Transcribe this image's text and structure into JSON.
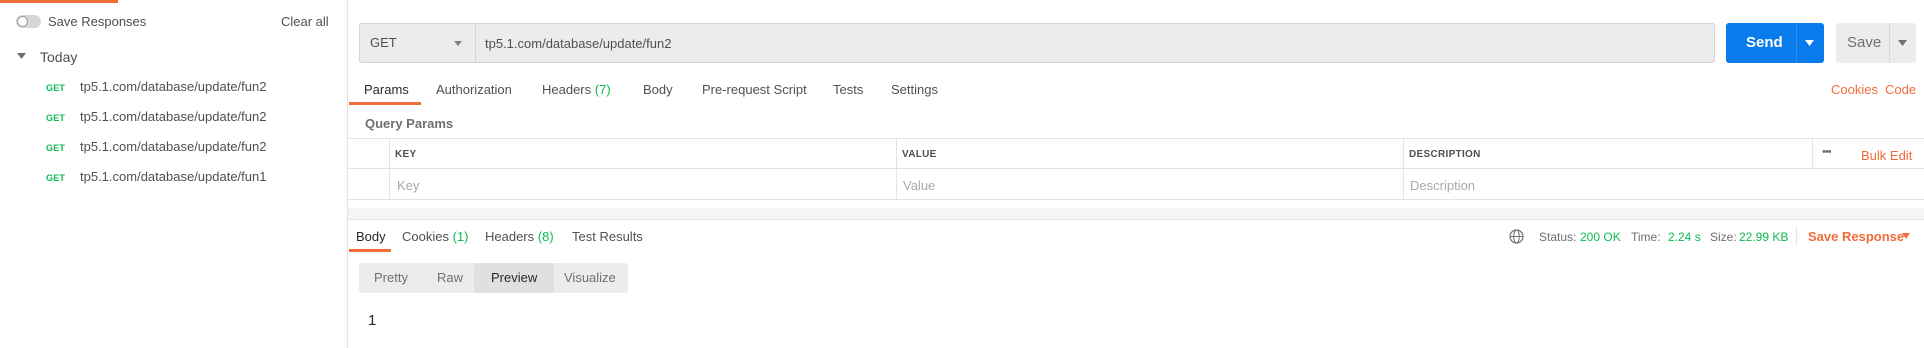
{
  "sidebar": {
    "save_responses_label": "Save Responses",
    "clear_all_label": "Clear all",
    "group_label": "Today",
    "history": [
      {
        "method": "GET",
        "url": "tp5.1.com/database/update/fun2"
      },
      {
        "method": "GET",
        "url": "tp5.1.com/database/update/fun2"
      },
      {
        "method": "GET",
        "url": "tp5.1.com/database/update/fun2"
      },
      {
        "method": "GET",
        "url": "tp5.1.com/database/update/fun1"
      }
    ]
  },
  "request": {
    "method": "GET",
    "url": "tp5.1.com/database/update/fun2",
    "send_label": "Send",
    "save_label": "Save"
  },
  "request_tabs": {
    "params": "Params",
    "authorization": "Authorization",
    "headers": "Headers",
    "headers_count": "(7)",
    "body": "Body",
    "prerequest": "Pre-request Script",
    "tests": "Tests",
    "settings": "Settings",
    "active": "Params"
  },
  "links": {
    "cookies": "Cookies",
    "code": "Code"
  },
  "params": {
    "section_label": "Query Params",
    "columns": [
      "KEY",
      "VALUE",
      "DESCRIPTION"
    ],
    "more_label": "•••",
    "bulk_edit_label": "Bulk Edit",
    "placeholders": {
      "key": "Key",
      "value": "Value",
      "description": "Description"
    }
  },
  "response": {
    "tabs": {
      "body": "Body",
      "cookies": "Cookies",
      "cookies_count": "(1)",
      "headers": "Headers",
      "headers_count": "(8)",
      "test_results": "Test Results",
      "active": "Body"
    },
    "status_label": "Status:",
    "status_value": "200 OK",
    "time_label": "Time:",
    "time_value": "2.24 s",
    "size_label": "Size:",
    "size_value": "22.99 KB",
    "save_response_label": "Save Response",
    "formats": [
      "Pretty",
      "Raw",
      "Preview",
      "Visualize"
    ],
    "active_format": "Preview",
    "body_text": "1"
  },
  "colors": {
    "accent": "#f26b3a",
    "primary": "#097bed",
    "success": "#0cbb52"
  },
  "icons": [
    "toggle-switch",
    "caret-down-icon",
    "globe-icon",
    "more-icon"
  ]
}
